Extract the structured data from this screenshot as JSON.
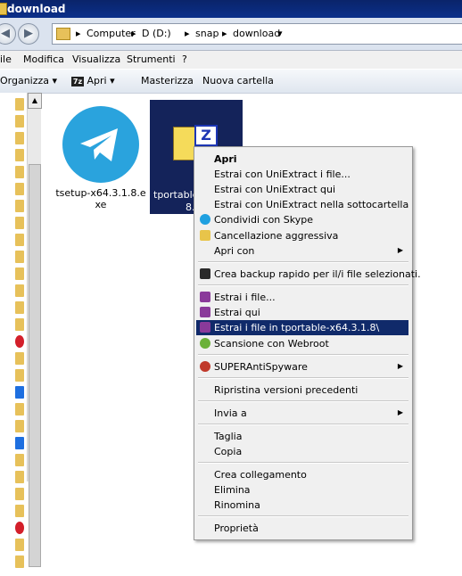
{
  "window": {
    "title": "download"
  },
  "address": {
    "segments": [
      "Computer",
      "D (D:)",
      "snap",
      "download"
    ]
  },
  "menubar": [
    "ile",
    "Modifica",
    "Visualizza",
    "Strumenti",
    "?"
  ],
  "toolbar": {
    "organize": "Organizza",
    "open_with": "Apri",
    "burn": "Masterizza",
    "new_folder": "Nuova cartella"
  },
  "files": [
    {
      "name_line1": "tsetup-x64.3.1.8.e",
      "name_line2": "xe"
    },
    {
      "name_line1": "tportable",
      "name_line2": "8."
    }
  ],
  "context_menu": {
    "items": [
      {
        "label": "Apri",
        "bold": true
      },
      {
        "label": "Estrai con UniExtract i file..."
      },
      {
        "label": "Estrai con UniExtract qui"
      },
      {
        "label": "Estrai con UniExtract nella sottocartella"
      },
      {
        "label": "Condividi con Skype"
      },
      {
        "label": "Cancellazione aggressiva"
      },
      {
        "label": "Apri con"
      },
      {
        "label": "Crea backup rapido per il/i file selezionati."
      },
      {
        "label": "Estrai i file..."
      },
      {
        "label": "Estrai qui"
      },
      {
        "label": "Estrai i file in tportable-x64.3.1.8\\"
      },
      {
        "label": "Scansione con Webroot"
      },
      {
        "label": "SUPERAntiSpyware"
      },
      {
        "label": "Ripristina versioni precedenti"
      },
      {
        "label": "Invia a"
      },
      {
        "label": "Taglia"
      },
      {
        "label": "Copia"
      },
      {
        "label": "Crea collegamento"
      },
      {
        "label": "Elimina"
      },
      {
        "label": "Rinomina"
      },
      {
        "label": "Proprietà"
      }
    ]
  },
  "colors": {
    "titlebar": "#0a246a",
    "highlight": "#102a6a",
    "telegram": "#2aa3dd"
  }
}
